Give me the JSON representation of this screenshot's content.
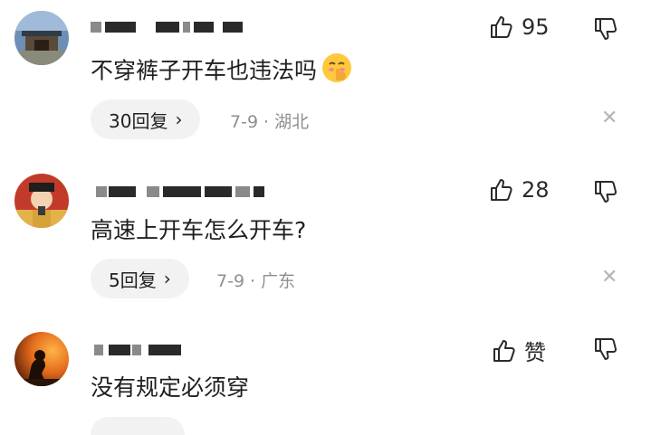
{
  "comments": [
    {
      "text": "不穿裤子开车也违法吗",
      "emoji": "shushing-face-emoji",
      "likes": "95",
      "replies": "30回复",
      "date": "7-9",
      "location": "湖北"
    },
    {
      "text": "高速上开车怎么开车?",
      "likes": "28",
      "replies": "5回复",
      "date": "7-9",
      "location": "广东"
    },
    {
      "text": "没有规定必须穿",
      "likes": "赞"
    }
  ],
  "icons": {
    "like": "thumbs-up-icon",
    "dislike": "thumbs-down-icon",
    "close": "close-icon",
    "chevron": "chevron-right-icon"
  },
  "symbols": {
    "dot": "·",
    "chevron": "›",
    "close": "✕"
  },
  "colors": {
    "text": "#1f1f1f",
    "meta": "#8f8f8f",
    "pill": "#f2f2f2"
  }
}
